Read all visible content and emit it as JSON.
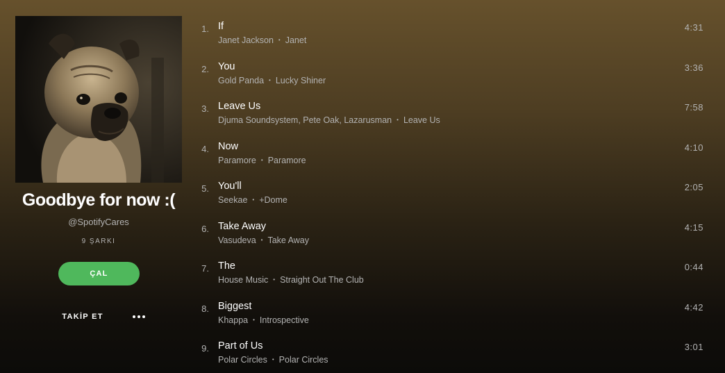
{
  "playlist": {
    "title": "Goodbye for now :(",
    "owner": "@SpotifyCares",
    "song_count": "9 ŞARKI",
    "play_label": "ÇAL",
    "follow_label": "TAKİP ET",
    "more_icon": "more-icon",
    "cover_icon": "pug-cover-art"
  },
  "colors": {
    "accent": "#4fb85c",
    "background_top": "#66512c",
    "background_bottom": "#0c0b09",
    "secondary_text": "#b3b3b3"
  },
  "tracks": [
    {
      "num": "1.",
      "title": "If",
      "artist": "Janet Jackson",
      "album": "Janet",
      "duration": "4:31"
    },
    {
      "num": "2.",
      "title": "You",
      "artist": "Gold Panda",
      "album": "Lucky Shiner",
      "duration": "3:36"
    },
    {
      "num": "3.",
      "title": "Leave Us",
      "artist": "Djuma Soundsystem, Pete Oak, Lazarusman",
      "album": "Leave Us",
      "duration": "7:58"
    },
    {
      "num": "4.",
      "title": "Now",
      "artist": "Paramore",
      "album": "Paramore",
      "duration": "4:10"
    },
    {
      "num": "5.",
      "title": "You'll",
      "artist": "Seekae",
      "album": "+Dome",
      "duration": "2:05"
    },
    {
      "num": "6.",
      "title": "Take Away",
      "artist": "Vasudeva",
      "album": "Take Away",
      "duration": "4:15"
    },
    {
      "num": "7.",
      "title": "The",
      "artist": "House Music",
      "album": "Straight Out The Club",
      "duration": "0:44"
    },
    {
      "num": "8.",
      "title": "Biggest",
      "artist": "Khappa",
      "album": "Introspective",
      "duration": "4:42"
    },
    {
      "num": "9.",
      "title": "Part of Us",
      "artist": "Polar Circles",
      "album": "Polar Circles",
      "duration": "3:01"
    }
  ]
}
